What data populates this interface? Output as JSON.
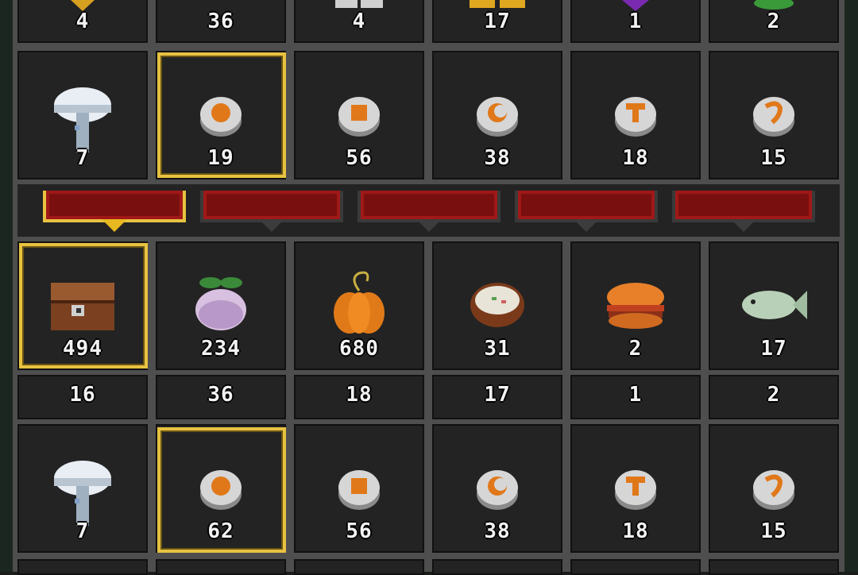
{
  "rows": [
    {
      "cells": [
        "4",
        "36",
        "4",
        "17",
        "1",
        "2"
      ]
    },
    {
      "cells": [
        "7",
        "19",
        "56",
        "38",
        "18",
        "15"
      ],
      "selected": 1
    },
    {
      "cells": [
        "494",
        "234",
        "680",
        "31",
        "2",
        "17"
      ],
      "selected": 0
    },
    {
      "cells": [
        "16",
        "36",
        "18",
        "17",
        "1",
        "2"
      ]
    },
    {
      "cells": [
        "7",
        "62",
        "56",
        "38",
        "18",
        "15"
      ],
      "selected": 1
    }
  ],
  "icons": {
    "row1": [
      "white-mushroom-icon",
      "pumpkin-cookie-icon",
      "skull-cookie-icon",
      "moon-cookie-icon",
      "wrench-cookie-icon",
      "hook-cookie-icon"
    ],
    "row2": [
      "treasure-chest-icon",
      "turnip-icon",
      "pumpkin-icon",
      "soup-bowl-icon",
      "burger-icon",
      "fish-icon"
    ],
    "row4": [
      "white-mushroom-icon",
      "pumpkin-cookie-icon",
      "skull-cookie-icon",
      "moon-cookie-icon",
      "wrench-cookie-icon",
      "hook-cookie-icon"
    ]
  },
  "tabs": {
    "count": 5,
    "active": 0
  },
  "colors": {
    "selection": "#e8c240",
    "tab": "#7a0f0f",
    "slot": "#232323",
    "grid": "#4e4e4e"
  }
}
